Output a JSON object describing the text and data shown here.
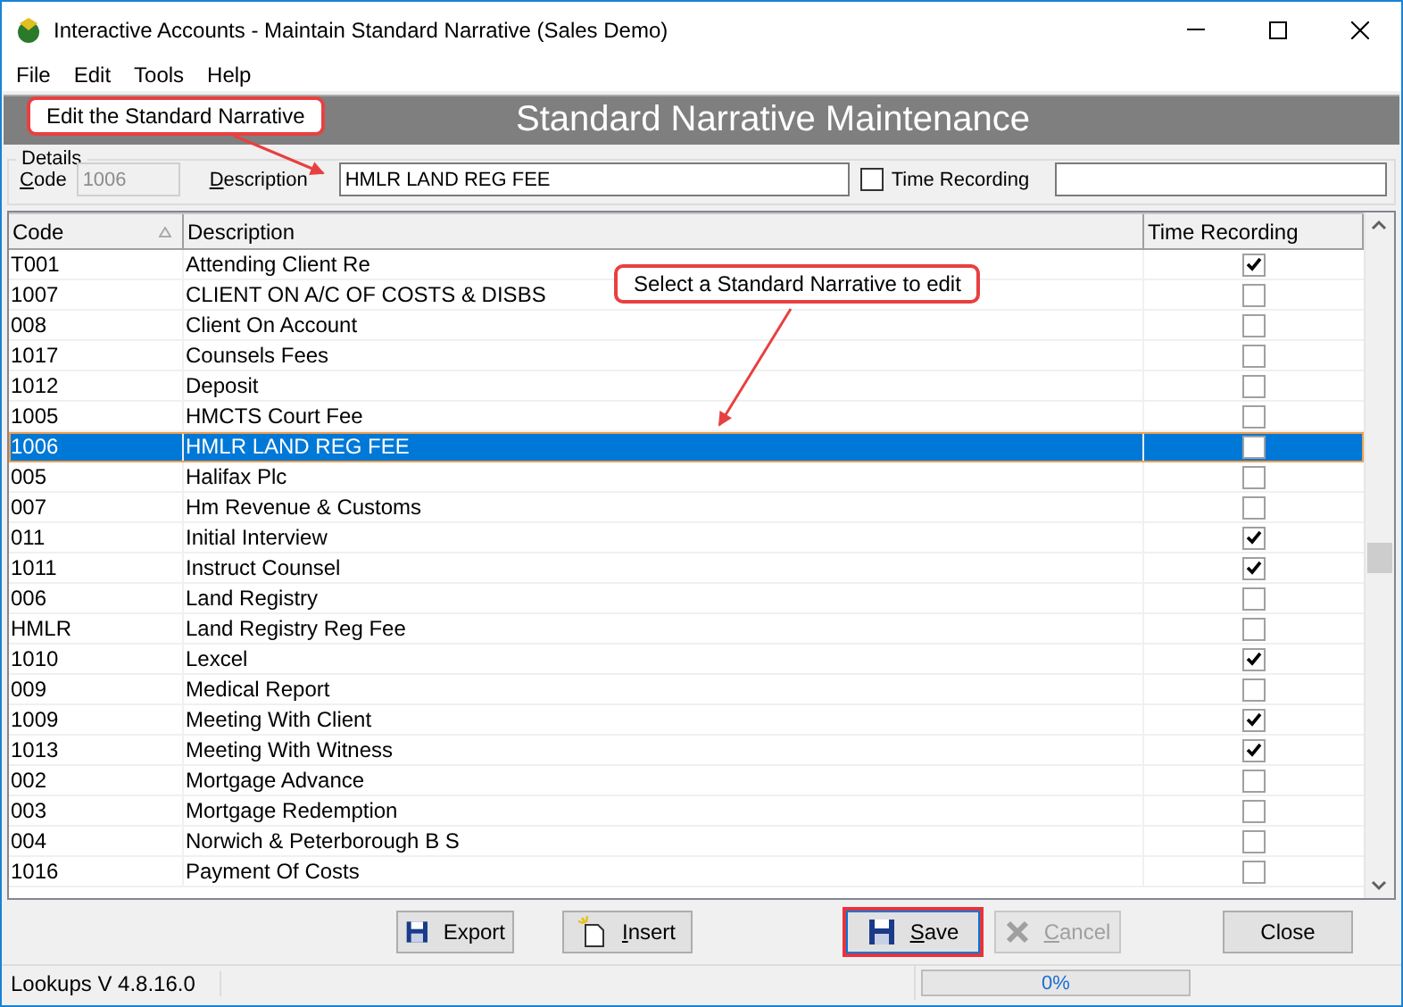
{
  "window": {
    "title": "Interactive Accounts - Maintain Standard Narrative (Sales Demo)"
  },
  "menu": [
    "File",
    "Edit",
    "Tools",
    "Help"
  ],
  "banner": {
    "title": "Standard Narrative Maintenance"
  },
  "details": {
    "legend": "Details",
    "code_label": "Code",
    "code_value": "1006",
    "description_label": "Description",
    "description_value": "HMLR LAND REG FEE",
    "time_recording_label": "Time Recording",
    "time_recording_checked": false
  },
  "table": {
    "columns": [
      {
        "label": "Code"
      },
      {
        "label": "Description"
      },
      {
        "label": "Time Recording"
      }
    ],
    "rows": [
      {
        "code": "T001",
        "description": "Attending Client Re",
        "time_recording": true,
        "selected": false
      },
      {
        "code": "1007",
        "description": "CLIENT ON A/C OF COSTS & DISBS",
        "time_recording": false,
        "selected": false
      },
      {
        "code": "008",
        "description": "Client On Account",
        "time_recording": false,
        "selected": false
      },
      {
        "code": "1017",
        "description": "Counsels Fees",
        "time_recording": false,
        "selected": false
      },
      {
        "code": "1012",
        "description": "Deposit",
        "time_recording": false,
        "selected": false
      },
      {
        "code": "1005",
        "description": "HMCTS Court Fee",
        "time_recording": false,
        "selected": false
      },
      {
        "code": "1006",
        "description": "HMLR LAND REG FEE",
        "time_recording": false,
        "selected": true
      },
      {
        "code": "005",
        "description": "Halifax Plc",
        "time_recording": false,
        "selected": false
      },
      {
        "code": "007",
        "description": "Hm Revenue & Customs",
        "time_recording": false,
        "selected": false
      },
      {
        "code": "011",
        "description": "Initial Interview",
        "time_recording": true,
        "selected": false
      },
      {
        "code": "1011",
        "description": "Instruct Counsel",
        "time_recording": true,
        "selected": false
      },
      {
        "code": "006",
        "description": "Land Registry",
        "time_recording": false,
        "selected": false
      },
      {
        "code": "HMLR",
        "description": "Land Registry Reg Fee",
        "time_recording": false,
        "selected": false
      },
      {
        "code": "1010",
        "description": "Lexcel",
        "time_recording": true,
        "selected": false
      },
      {
        "code": "009",
        "description": "Medical Report",
        "time_recording": false,
        "selected": false
      },
      {
        "code": "1009",
        "description": "Meeting With Client",
        "time_recording": true,
        "selected": false
      },
      {
        "code": "1013",
        "description": "Meeting With Witness",
        "time_recording": true,
        "selected": false
      },
      {
        "code": "002",
        "description": "Mortgage Advance",
        "time_recording": false,
        "selected": false
      },
      {
        "code": "003",
        "description": "Mortgage Redemption",
        "time_recording": false,
        "selected": false
      },
      {
        "code": "004",
        "description": "Norwich & Peterborough B S",
        "time_recording": false,
        "selected": false
      },
      {
        "code": "1016",
        "description": "Payment Of Costs",
        "time_recording": false,
        "selected": false
      }
    ]
  },
  "buttons": [
    {
      "label": "Export",
      "kind": "floppy",
      "disabled": false,
      "focused": false
    },
    {
      "label": "Insert",
      "kind": "new",
      "disabled": false,
      "focused": false
    },
    {
      "label": "Save",
      "kind": "floppy",
      "disabled": false,
      "focused": true
    },
    {
      "label": "Cancel",
      "kind": "cross",
      "disabled": true,
      "focused": false
    },
    {
      "label": "Close",
      "kind": "plain",
      "disabled": false,
      "focused": false
    }
  ],
  "status_bar": {
    "version": "Lookups V 4.8.16.0",
    "progress": {
      "level": 0,
      "reading": "0%"
    }
  },
  "callouts": [
    {
      "text": "Edit the Standard Narrative"
    },
    {
      "text": "Select a Standard Narrative to edit"
    }
  ]
}
